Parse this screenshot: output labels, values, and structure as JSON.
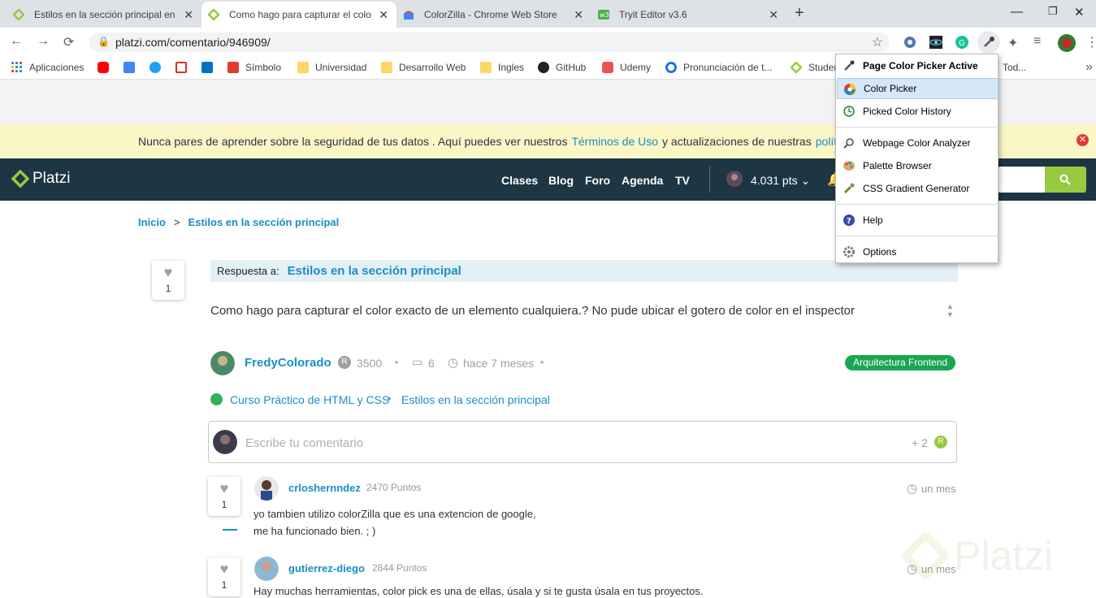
{
  "browser": {
    "tabs": [
      {
        "title": "Estilos en la sección principal en",
        "active": false,
        "favicon": "platzi-icon"
      },
      {
        "title": "Como hago para capturar el colo",
        "active": true,
        "favicon": "platzi-icon"
      },
      {
        "title": "ColorZilla - Chrome Web Store",
        "active": false,
        "favicon": "chrome-web-store-icon"
      },
      {
        "title": "Tryit Editor v3.6",
        "active": false,
        "favicon": "w3schools-icon"
      }
    ],
    "new_tab": "+",
    "url": "platzi.com/comentario/946909/",
    "bookmarks": [
      {
        "label": "Aplicaciones",
        "icon": "apps-grid-icon"
      },
      {
        "label": "",
        "icon": "youtube-icon"
      },
      {
        "label": "",
        "icon": "translate-icon"
      },
      {
        "label": "",
        "icon": "twitter-icon"
      },
      {
        "label": "",
        "icon": "gmail-icon"
      },
      {
        "label": "",
        "icon": "outlook-icon"
      },
      {
        "label": "Símbolo",
        "icon": "symbol-icon"
      },
      {
        "label": "Universidad",
        "icon": "folder-icon"
      },
      {
        "label": "Desarrollo Web",
        "icon": "folder-icon"
      },
      {
        "label": "Ingles",
        "icon": "folder-icon"
      },
      {
        "label": "GitHub",
        "icon": "github-icon"
      },
      {
        "label": "Udemy",
        "icon": "udemy-icon"
      },
      {
        "label": "Pronunciación de t...",
        "icon": "pronunciation-icon"
      },
      {
        "label": "Studen",
        "icon": "platzi-icon"
      },
      {
        "label": "Tod...",
        "icon": "folder-icon"
      }
    ],
    "more_bookmarks": "»"
  },
  "colorzilla_menu": {
    "items": [
      {
        "label": "Page Color Picker Active",
        "icon": "eyedropper-icon",
        "bold": true
      },
      {
        "label": "Color Picker",
        "icon": "color-wheel-icon",
        "highlighted": true
      },
      {
        "label": "Picked Color History",
        "icon": "history-icon"
      },
      {
        "label": "Webpage Color Analyzer",
        "icon": "magnifier-icon"
      },
      {
        "label": "Palette Browser",
        "icon": "palette-icon"
      },
      {
        "label": "CSS Gradient Generator",
        "icon": "gradient-icon"
      },
      {
        "label": "Help",
        "icon": "help-icon"
      },
      {
        "label": "Options",
        "icon": "gear-icon"
      }
    ]
  },
  "cookie_banner": {
    "text": "Nunca pares de aprender sobre la seguridad de tus datos . Aquí puedes ver nuestros",
    "link1": "Términos de Uso",
    "middle": "y actualizaciones de nuestras",
    "link2": "políticas de"
  },
  "platzi_nav": {
    "logo": "Platzi",
    "links": [
      "Clases",
      "Blog",
      "Foro",
      "Agenda",
      "TV"
    ],
    "points": "4.031 pts"
  },
  "breadcrumb": {
    "home": "Inicio",
    "sep": ">",
    "current": "Estilos en la sección principal"
  },
  "question": {
    "likes": "1",
    "reply_label": "Respuesta a:",
    "reply_title": "Estilos en la sección principal",
    "text": "Como hago para capturar el color exacto de un elemento cualquiera.? No pude ubicar el gotero de color en el inspector",
    "author": "FredyColorado",
    "author_points": "3500",
    "comments": "6",
    "time": "hace 7 meses",
    "tag": "Arquitectura Frontend",
    "course": "Curso Práctico de HTML y CSS",
    "course_sep": "•",
    "section": "Estilos en la sección principal",
    "comment_placeholder": "Escribe tu comentario",
    "comment_bonus": "+ 2"
  },
  "answers": [
    {
      "likes": "1",
      "author": "crloshernndez",
      "points": "2470 Puntos",
      "time": "un mes",
      "lines": [
        "yo tambien utilizo colorZilla que es una extencion de google,",
        "me ha funcionado bien. ; )"
      ]
    },
    {
      "likes": "1",
      "author": "gutierrez-diego",
      "points": "2844 Puntos",
      "time": "un mes",
      "lines": [
        "Hay muchas herramientas, color pick es una de ellas, úsala y si te gusta úsala en tus proyectos."
      ]
    }
  ],
  "watermark": "Platzi",
  "colors": {
    "platzi_green": "#98ca3f",
    "nav_bg": "#1c3643",
    "link_blue": "#1a8ec4",
    "tag_green": "#1aa551"
  }
}
